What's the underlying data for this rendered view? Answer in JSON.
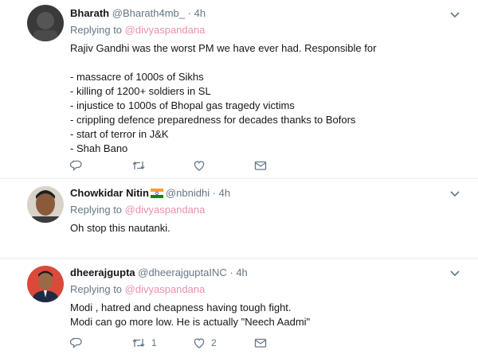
{
  "tweets": [
    {
      "name": "Bharath",
      "handle": "@Bharath4mb_",
      "separator": "·",
      "time": "4h",
      "replying_label": "Replying to",
      "replying_to": "@divyaspandana",
      "text": "Rajiv Gandhi was the worst PM we have ever had. Responsible for\n\n- massacre of 1000s of Sikhs\n- killing of 1200+ soldiers in SL\n- injustice to 1000s of Bhopal gas tragedy victims\n- crippling defence preparedness for decades thanks to Bofors\n- start of terror in J&K\n- Shah Bano",
      "retweet_count": "",
      "like_count": ""
    },
    {
      "name": "Chowkidar Nitin",
      "handle": "@nbnidhi",
      "separator": "·",
      "time": "4h",
      "replying_label": "Replying to",
      "replying_to": "@divyaspandana",
      "text": "Oh stop this nautanki.",
      "retweet_count": "",
      "like_count": ""
    },
    {
      "name": "dheerajgupta",
      "handle": "@dheerajguptaINC",
      "separator": "·",
      "time": "4h",
      "replying_label": "Replying to",
      "replying_to": "@divyaspandana",
      "text": "Modi , hatred and cheapness having tough fight.\nModi can go more low. He is actually \"Neech Aadmi\"",
      "retweet_count": "1",
      "like_count": "2"
    }
  ],
  "icons": {
    "reply": "reply-icon",
    "retweet": "retweet-icon",
    "like": "heart-icon",
    "dm": "envelope-icon",
    "menu": "chevron-down-icon",
    "flag": "india-flag-icon"
  },
  "colors": {
    "icon": "#657786",
    "mention": "#e991a8",
    "divider": "#e6ecf0"
  }
}
